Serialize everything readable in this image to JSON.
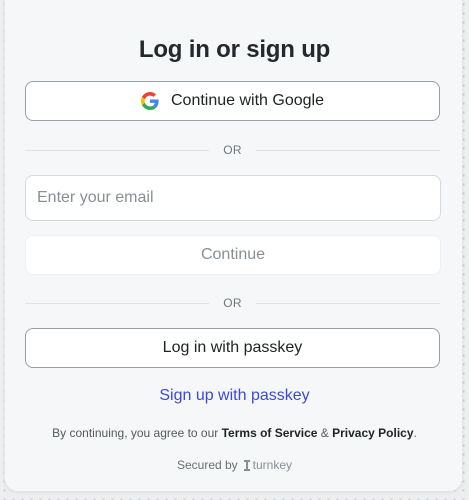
{
  "title": "Log in or sign up",
  "google_button": {
    "label": "Continue with Google",
    "icon": "google-icon"
  },
  "divider_text": "OR",
  "email_input": {
    "placeholder": "Enter your email",
    "value": ""
  },
  "continue_button": {
    "label": "Continue"
  },
  "passkey_button": {
    "label": "Log in with passkey"
  },
  "signup_link": {
    "label": "Sign up with passkey"
  },
  "terms": {
    "prefix": "By continuing, you agree to our ",
    "terms_link": "Terms of Service",
    "separator": " & ",
    "privacy_link": "Privacy Policy",
    "suffix": "."
  },
  "footer": {
    "secured_label": "Secured by",
    "brand": "turnkey",
    "brand_icon": "turnkey-logo-icon"
  },
  "colors": {
    "link": "#3d47d8",
    "text": "#23272e",
    "muted": "#8a8f96",
    "card_bg": "#f5f7f9"
  }
}
